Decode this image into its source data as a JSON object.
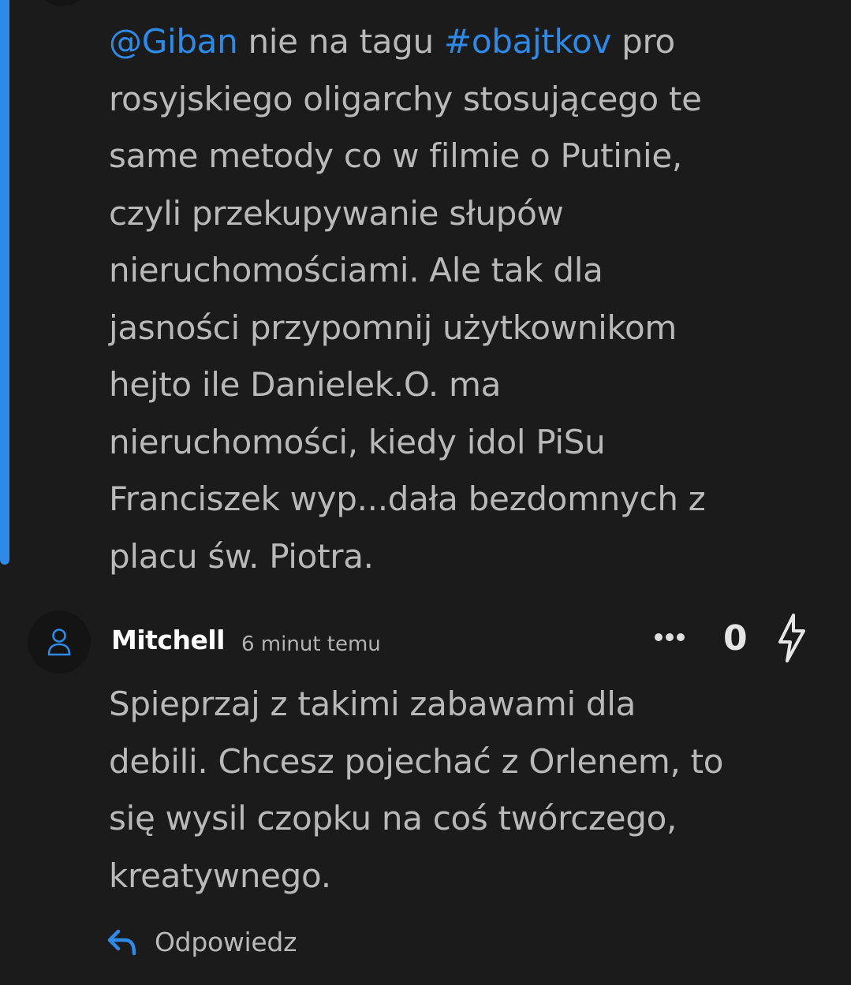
{
  "thread": {
    "accent_color": "#2e8ae6"
  },
  "comment_1": {
    "mention": "@Giban",
    "text_a": " nie na tagu ",
    "hashtag": "#obajtkov",
    "text_b": " pro",
    "lines": [
      "rosyjskiego oligarchy stosującego te",
      "same metody co w filmie o Putinie,",
      "czyli przekupywanie słupów",
      "nieruchomościami. Ale tak dla",
      "jasności przypomnij użytkownikom",
      "hejto ile Danielek.O. ma",
      "nieruchomości, kiedy idol PiSu",
      "Franciszek wyp...dała bezdomnych z",
      "placu św. Piotra."
    ]
  },
  "comment_2": {
    "avatar_icon": "user-icon",
    "author": "Mitchell",
    "time": "6 minut temu",
    "more_icon": "more-dots-icon",
    "score": "0",
    "vote_icon": "lightning-icon",
    "lines": [
      "Spieprzaj z takimi zabawami dla",
      "debili. Chcesz pojechać z Orlenem, to",
      "się wysil czopku na coś twórczego,",
      "kreatywnego."
    ],
    "reply_icon": "reply-arrow-icon",
    "reply_label": "Odpowiedz"
  }
}
